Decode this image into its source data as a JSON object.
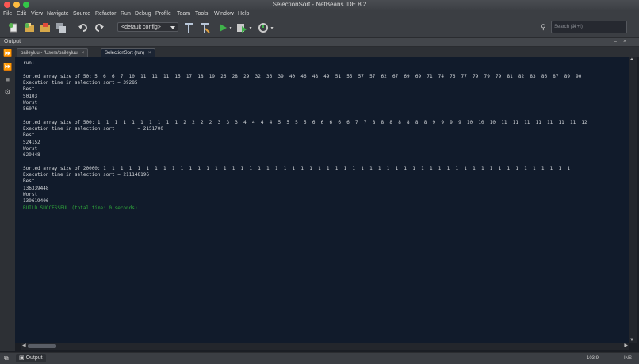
{
  "window": {
    "title": "SelectionSort - NetBeans IDE 8.2"
  },
  "menu": [
    "File",
    "Edit",
    "View",
    "Navigate",
    "Source",
    "Refactor",
    "Run",
    "Debug",
    "Profile",
    "Team",
    "Tools",
    "Window",
    "Help"
  ],
  "toolbar": {
    "config": "<default config>",
    "search_placeholder": "Search (⌘+I)",
    "icons": [
      "new-file-icon",
      "new-project-icon",
      "open-project-icon",
      "save-all-icon",
      "undo-icon",
      "redo-icon",
      "config-dropdown",
      "build-hammer-icon",
      "clean-build-icon",
      "run-icon",
      "debug-icon",
      "profile-icon"
    ]
  },
  "panel": {
    "title": "Output",
    "controls": [
      "‒",
      "×"
    ]
  },
  "tabs": [
    {
      "label": "baileyluu - /Users/baileyluu",
      "active": false
    },
    {
      "label": "SelectionSort (run)",
      "active": true
    }
  ],
  "output_lines": [
    {
      "text": "run:",
      "type": "normal"
    },
    {
      "text": "",
      "type": "normal"
    },
    {
      "text": "Sorted array size of 50: 5  6  6  7  10  11  11  11  15  17  18  19  26  28  29  32  36  39  40  46  48  49  51  55  57  57  62  67  69  69  71  74  76  77  79  79  79  81  82  83  86  87  89  90",
      "type": "normal"
    },
    {
      "text": "Execution time in selection sort = 39285",
      "type": "normal"
    },
    {
      "text": "Best",
      "type": "normal"
    },
    {
      "text": "50103",
      "type": "normal"
    },
    {
      "text": "Worst",
      "type": "normal"
    },
    {
      "text": "56076",
      "type": "normal"
    },
    {
      "text": "",
      "type": "normal"
    },
    {
      "text": "Sorted array size of 500: 1  1  1  1  1  1  1  1  1  1  2  2  2  2  3  3  3  4  4  4  4  5  5  5  5  6  6  6  6  6  7  7  8  8  8  8  8  8  8  9  9  9  9  10  10  10  11  11  11  11  11  11  11  12",
      "type": "normal"
    },
    {
      "text": "Execution time in selection sort        = 2151700",
      "type": "normal"
    },
    {
      "text": "Best",
      "type": "normal"
    },
    {
      "text": "524152",
      "type": "normal"
    },
    {
      "text": "Worst",
      "type": "normal"
    },
    {
      "text": "629448",
      "type": "normal"
    },
    {
      "text": "",
      "type": "normal"
    },
    {
      "text": "Sorted array size of 20000: 1  1  1  1  1  1  1  1  1  1  1  1  1  1  1  1  1  1  1  1  1  1  1  1  1  1  1  1  1  1  1  1  1  1  1  1  1  1  1  1  1  1  1  1  1  1  1  1  1  1  1  1  1  1  1",
      "type": "normal"
    },
    {
      "text": "Execution time in selection sort = 211148196",
      "type": "normal"
    },
    {
      "text": "Best",
      "type": "normal"
    },
    {
      "text": "136339448",
      "type": "normal"
    },
    {
      "text": "Worst",
      "type": "normal"
    },
    {
      "text": "139619406",
      "type": "normal"
    },
    {
      "text": "BUILD SUCCESSFUL (total time: 0 seconds)",
      "type": "success"
    }
  ],
  "status": {
    "tab": "Output",
    "position": "103:9",
    "mode": "INS"
  },
  "colors": {
    "success": "#2fa83b",
    "output_bg": "#111b2b",
    "chrome": "#3b3e43"
  }
}
